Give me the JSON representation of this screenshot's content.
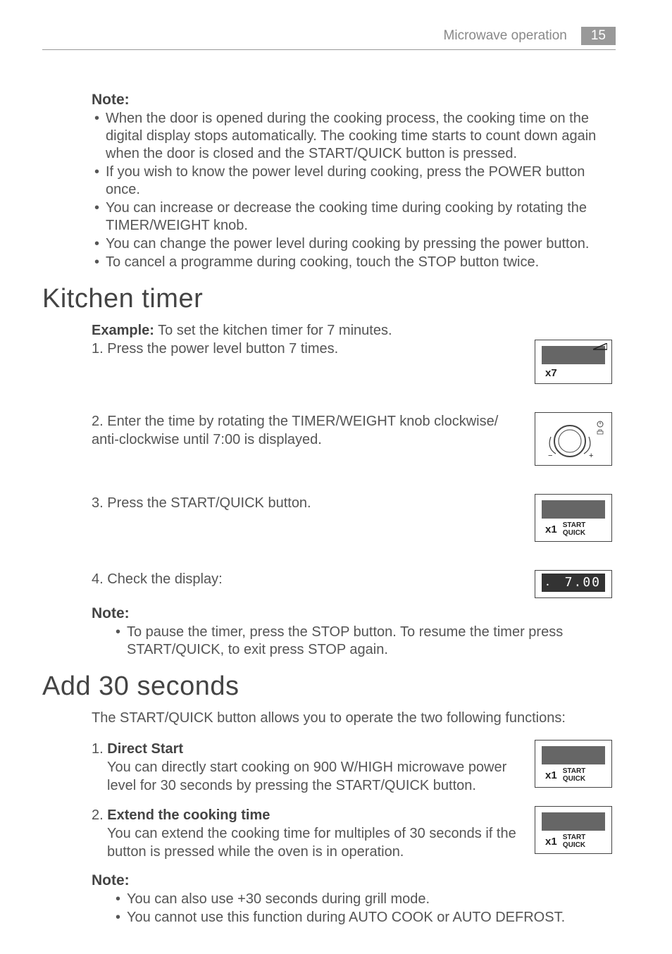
{
  "header": {
    "section": "Microwave operation",
    "page": "15"
  },
  "noteTop": {
    "label": "Note:",
    "items": [
      "When the door is opened during the cooking process, the cooking time on the digital display stops automatically. The cooking time starts to count down again when the door is closed and the START/QUICK button is pressed.",
      "If you wish to know the power level during cooking, press the POWER button once.",
      "You can increase or decrease the cooking time during cooking by rotating the TIMER/WEIGHT knob.",
      "You can change the power level during cooking by pressing the power button.",
      "To cancel a programme during cooking, touch the STOP button twice."
    ]
  },
  "kitchenTimer": {
    "title": "Kitchen timer",
    "exampleLabel": "Example:",
    "exampleText": " To set the kitchen timer for 7 minutes.",
    "steps": [
      {
        "num": "1.",
        "text": "Press the power level button 7 times.",
        "fig": {
          "type": "button",
          "x": "x7",
          "wedge": true
        }
      },
      {
        "num": "2.",
        "text": "Enter the time by rotating the TIMER/WEIGHT knob clockwise/ anti-clockwise until 7:00 is displayed.",
        "fig": {
          "type": "knob"
        }
      },
      {
        "num": "3.",
        "text": "Press the START/QUICK button.",
        "fig": {
          "type": "startquick",
          "x": "x1",
          "line1": "START",
          "line2": "QUICK"
        }
      },
      {
        "num": "4.",
        "text": "Check the display:",
        "fig": {
          "type": "display",
          "value": "7.00"
        }
      }
    ],
    "footerNote": {
      "label": "Note:",
      "items": [
        "To pause the timer, press the STOP button. To resume the timer press START/QUICK, to exit press STOP again."
      ]
    }
  },
  "add30": {
    "title": "Add 30 seconds",
    "intro": "The START/QUICK button allows you to operate the two following functions:",
    "functions": [
      {
        "num": "1.",
        "title": "Direct Start",
        "text": "You can directly start cooking on 900 W/HIGH microwave power level for 30 seconds by pressing the START/QUICK button.",
        "fig": {
          "type": "startquick",
          "x": "x1",
          "line1": "START",
          "line2": "QUICK"
        }
      },
      {
        "num": "2.",
        "title": "Extend the cooking time",
        "text": "You can extend the cooking time for multiples of 30 seconds if the button is pressed while the oven is in operation.",
        "fig": {
          "type": "startquick",
          "x": "x1",
          "line1": "START",
          "line2": "QUICK"
        }
      }
    ],
    "footerNote": {
      "label": "Note:",
      "items": [
        "You can also use +30 seconds during grill mode.",
        "You cannot use this function during AUTO COOK or AUTO DEFROST."
      ]
    }
  }
}
